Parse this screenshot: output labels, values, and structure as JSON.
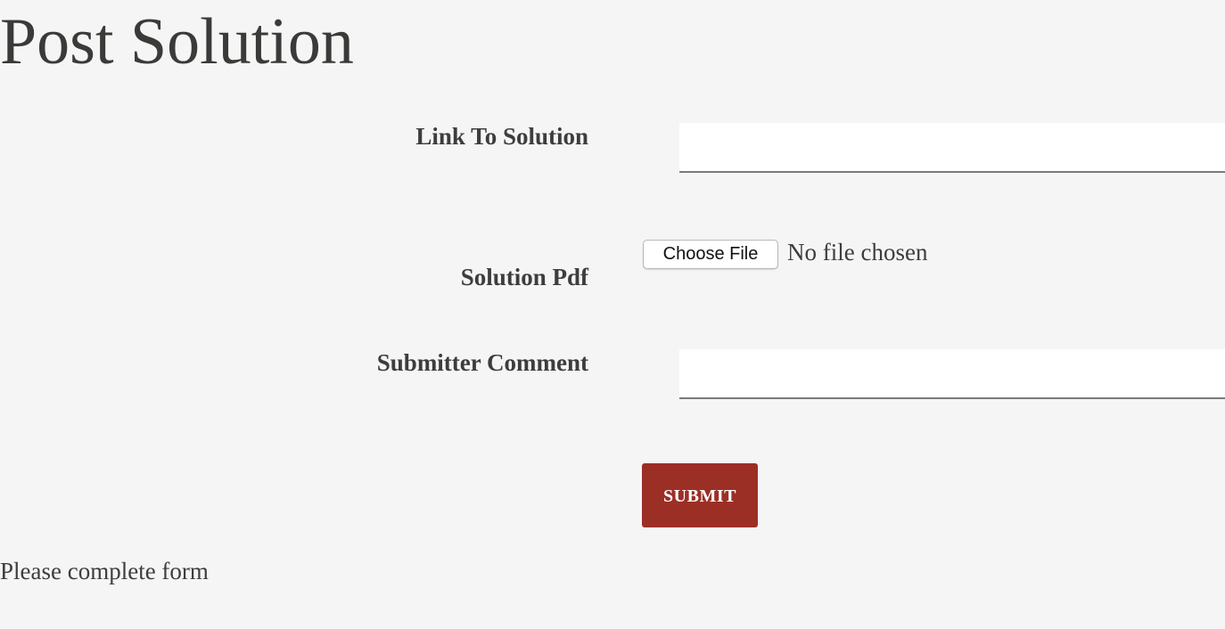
{
  "page": {
    "title": "Post Solution"
  },
  "form": {
    "link_label": "Link To Solution",
    "link_value": "",
    "pdf_label": "Solution Pdf",
    "file_button_label": "Choose File",
    "file_status": "No file chosen",
    "comment_label": "Submitter Comment",
    "comment_value": "",
    "submit_label": "SUBMIT",
    "message": "Please complete form"
  },
  "colors": {
    "background": "#f5f5f5",
    "submit_button": "#9c2f25",
    "text": "#3d3d3d"
  }
}
